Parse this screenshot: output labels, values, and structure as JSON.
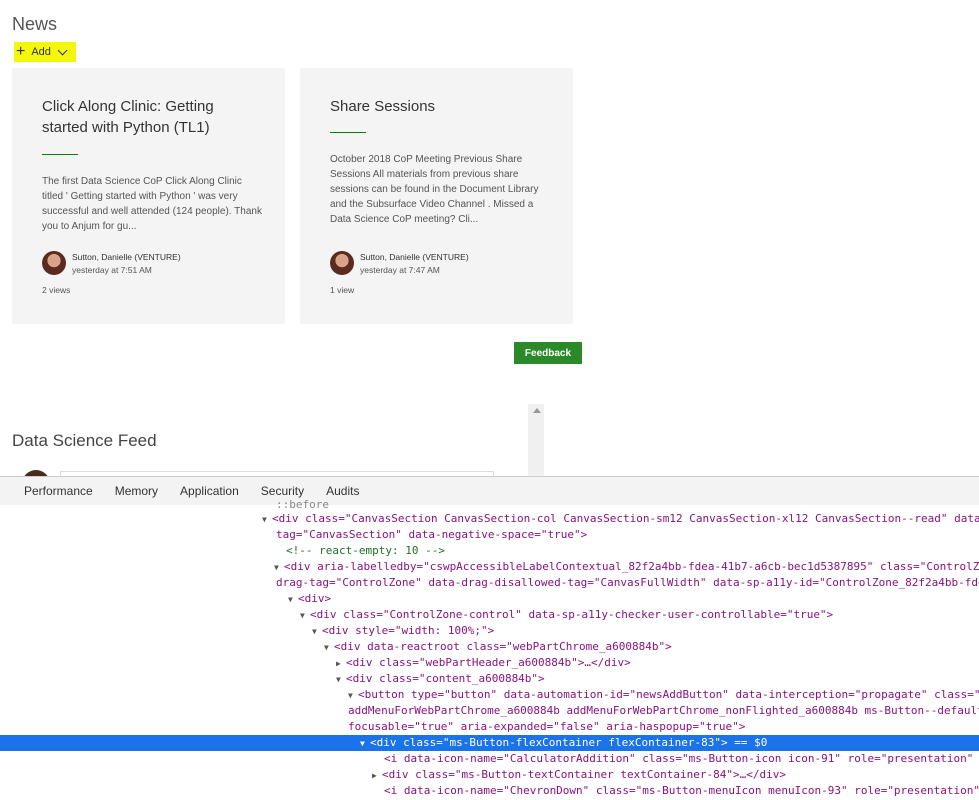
{
  "news": {
    "title": "News",
    "add_label": "Add",
    "cards": [
      {
        "title": "Click Along Clinic: Getting started with Python (TL1)",
        "excerpt": "The first Data Science CoP Click Along Clinic titled ' Getting started with Python ' was very successful and well attended (124 people). Thank you to Anjum for gu...",
        "author": "Sutton, Danielle (VENTURE)",
        "time": "yesterday at 7:51 AM",
        "views": "2 views"
      },
      {
        "title": "Share Sessions",
        "excerpt": "October 2018 CoP Meeting Previous Share Sessions All materials from previous share sessions can be found in the Document Library and the Subsurface Video Channel . Missed a Data Science CoP meeting? Cli...",
        "author": "Sutton, Danielle (VENTURE)",
        "time": "yesterday at 7:47 AM",
        "views": "1 view"
      }
    ]
  },
  "feedback_label": "Feedback",
  "feed": {
    "title": "Data Science Feed"
  },
  "devtools": {
    "tabs": [
      "Performance",
      "Memory",
      "Application",
      "Security",
      "Audits"
    ],
    "lines": [
      "::before",
      "<div class=\"CanvasSection CanvasSection-col CanvasSection-sm12 CanvasSection-xl12 CanvasSection--read\" data",
      "tag=\"CanvasSection\" data-negative-space=\"true\">",
      "<!-- react-empty: 10 -->",
      "<div aria-labelledby=\"cswpAccessibleLabelContextual_82f2a4bb-fdea-41b7-a6cb-bec1d5387895\" class=\"ControlZ",
      "drag-tag=\"ControlZone\" data-drag-disallowed-tag=\"CanvasFullWidth\" data-sp-a11y-id=\"ControlZone_82f2a4bb-fde",
      "<div>",
      "<div class=\"ControlZone-control\" data-sp-a11y-checker-user-controllable=\"true\">",
      "<div style=\"width: 100%;\">",
      "<div data-reactroot class=\"webPartChrome_a600884b\">",
      "<div class=\"webPartHeader_a600884b\">…</div>",
      "<div class=\"content_a600884b\">",
      "<button type=\"button\" data-automation-id=\"newsAddButton\" data-interception=\"propagate\" class=\"m",
      "addMenuForWebPartChrome_a600884b addMenuForWebPartChrome_nonFlighted_a600884b ms-Button--default",
      "focusable=\"true\" aria-expanded=\"false\" aria-haspopup=\"true\">",
      "<div class=\"ms-Button-flexContainer flexContainer-83\"> == $0",
      "<i data-icon-name=\"CalculatorAddition\" class=\"ms-Button-icon icon-91\" role=\"presentation\" a",
      "<div class=\"ms-Button-textContainer textContainer-84\">…</div>",
      "<i data-icon-name=\"ChevronDown\" class=\"ms-Button-menuIcon menuIcon-93\" role=\"presentation\""
    ]
  }
}
